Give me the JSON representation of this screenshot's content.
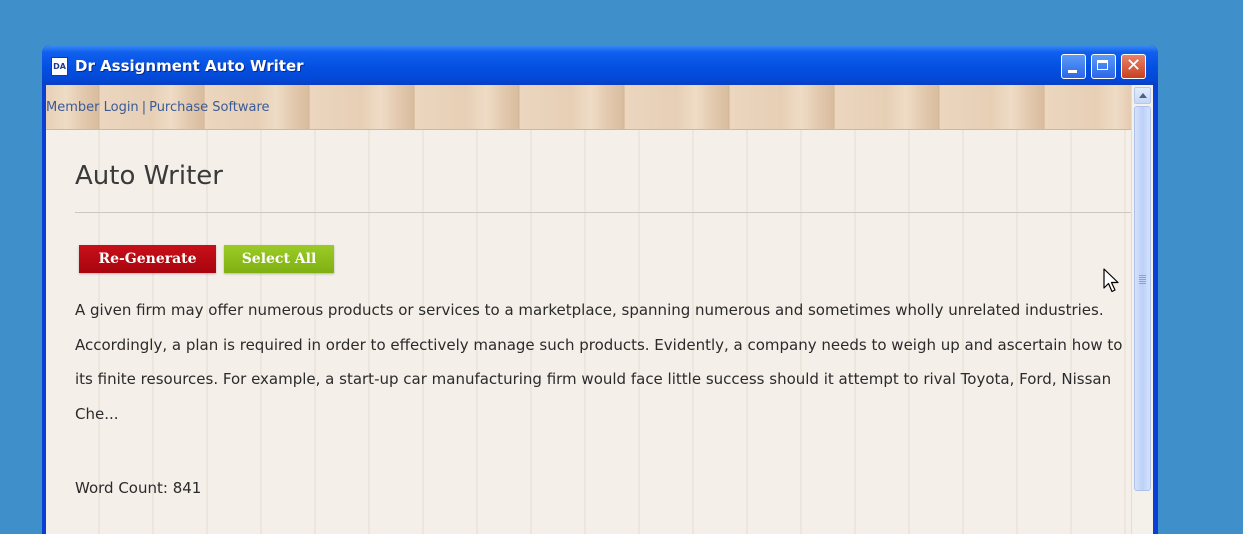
{
  "window": {
    "title": "Dr Assignment Auto Writer",
    "icon_label": "DA",
    "close_glyph": "✕"
  },
  "top_links": {
    "member_login": "Member Login",
    "separator": "|",
    "purchase_software": "Purchase Software"
  },
  "main": {
    "title": "Auto Writer",
    "regenerate_label": "Re-Generate",
    "select_all_label": "Select All",
    "text_lines": [
      "A given firm may offer numerous products or services to a marketplace, spanning numerous and sometimes wholly unrelated industries.",
      "Accordingly, a plan is required in order to effectively manage such products. Evidently, a company needs to weigh up and ascertain how to",
      "its finite resources. For example, a start-up car manufacturing firm would face little success should it attempt to rival Toyota, Ford, Nissan",
      "Che..."
    ],
    "word_count": "Word Count: 841"
  },
  "colors": {
    "desktop": "#3f8fcb",
    "regenerate_button": "#b80812",
    "select_all_button": "#8cbd1c",
    "link": "#3a5b97"
  },
  "icons": {
    "app": "app-icon",
    "minimize": "minimize-icon",
    "maximize": "maximize-icon",
    "close": "close-icon",
    "scroll_up": "scroll-up-arrow-icon",
    "cursor": "mouse-pointer-icon"
  }
}
